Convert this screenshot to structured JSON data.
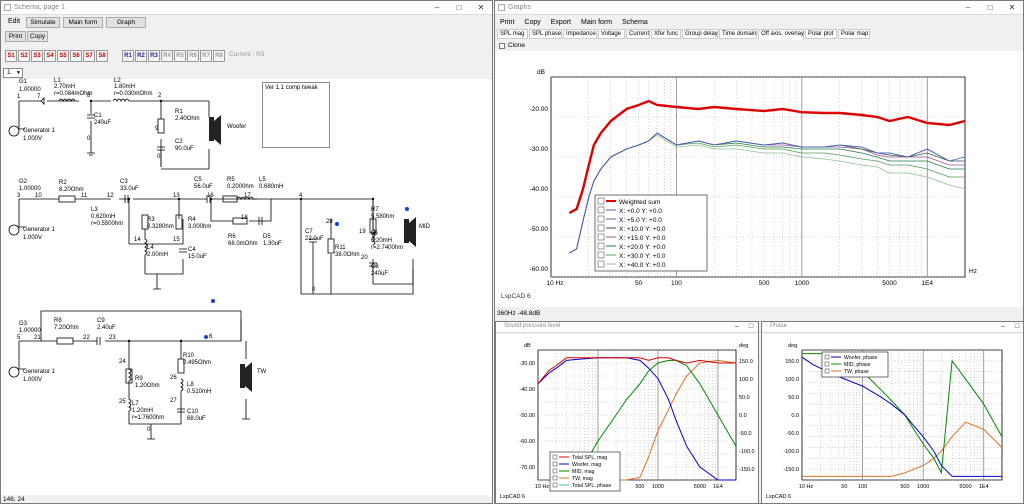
{
  "schema_window": {
    "title": "Schema, page 1",
    "menu": [
      "Edit",
      "Simulate",
      "Main form",
      "Graph"
    ],
    "buttons": [
      "Print",
      "Copy"
    ],
    "s_buttons": [
      "S1",
      "S2",
      "S3",
      "S4",
      "S5",
      "S6",
      "S7",
      "S8"
    ],
    "r_buttons": [
      "R1",
      "R2",
      "R3",
      "R4",
      "R5",
      "R6",
      "R7",
      "R8"
    ],
    "current_label": "Current : R3",
    "page_select": "1",
    "note": "Ver 1.1 comp tweak",
    "status": "146, 24"
  },
  "circuit": {
    "g1": [
      "G1",
      "1.00000",
      "1",
      "7"
    ],
    "gen1": [
      "Generator 1",
      "1.000V"
    ],
    "l1": [
      "L1",
      "2.70mH",
      "r=0.084mOhm",
      "8"
    ],
    "l2": [
      "L2",
      "1.80mH",
      "r=0.030mOhm",
      "2"
    ],
    "c1": [
      "C1",
      "240uF",
      "0"
    ],
    "r1": [
      "R1",
      "2.40Ohm",
      "9"
    ],
    "c2": [
      "C2",
      "90.0uF",
      "0"
    ],
    "woofer": "Woofer",
    "g2": [
      "G2",
      "1.00000",
      "3",
      "10"
    ],
    "r2": [
      "R2",
      "8.20Ohm",
      "11"
    ],
    "c3": [
      "C3",
      "33.0uF",
      "12",
      "13"
    ],
    "c5": [
      "C5",
      "56.0uF",
      "16"
    ],
    "r5": [
      "R5",
      "0.2000hm",
      "17"
    ],
    "l5": [
      "L5",
      "0.680mH",
      "4"
    ],
    "gen2": [
      "Generator 1",
      "1.000V"
    ],
    "l3": [
      "L3",
      "0.620mH",
      "r=0.5500hm"
    ],
    "r3": [
      "R3",
      "0.3280hm",
      "14"
    ],
    "l4": [
      "L4",
      "2.00mH"
    ],
    "r4": [
      "R4",
      "3.000hm",
      "15"
    ],
    "c4": [
      "C4",
      "15.0uF"
    ],
    "r6": [
      "18",
      "R6",
      "68.0mOhm"
    ],
    "d5": [
      "D5",
      "1.30uF"
    ],
    "c7": [
      "C7",
      "22.0uF",
      "0"
    ],
    "n28": "28",
    "r11": [
      "R11",
      "38.0Ohm",
      "20"
    ],
    "r7": [
      "R7",
      "5.580hm",
      "19"
    ],
    "l6": [
      "L6",
      "6.20mH",
      "r=2.7400hm"
    ],
    "c8": [
      "C8",
      "240uF"
    ],
    "mid": "MID",
    "g3": [
      "G3",
      "1.00000",
      "5",
      "21"
    ],
    "r8": [
      "R8",
      "7.20Ohm",
      "22"
    ],
    "c9": [
      "C9",
      "2.40uF",
      "23"
    ],
    "n6": "6",
    "gen3": [
      "Generator 1",
      "1.000V"
    ],
    "r9": [
      "R9",
      "1.20Ohm",
      "24",
      "25"
    ],
    "l7": [
      "L7",
      "1.20mH",
      "r=1.7600hm"
    ],
    "r10": [
      "R10",
      "0.495Ohm",
      "26"
    ],
    "l8": [
      "L8",
      "0.510mH",
      "27"
    ],
    "c10": [
      "C10",
      "68.0uF"
    ],
    "n0": "0",
    "tw": "TW"
  },
  "graphs_window": {
    "title": "Graphs",
    "menu": [
      "Print",
      "Copy",
      "Export",
      "Main form",
      "Schema"
    ],
    "tabs": [
      "SPL mag",
      "SPL phase",
      "Impedance",
      "Voltage",
      "Current",
      "Xfer func",
      "Group delay",
      "Time domain",
      "Off axis, overlay",
      "Polar plot",
      "Polar map"
    ],
    "selected_tab": "Off axis, overlay",
    "clone_label": "Clone",
    "status": "360Hz  -48.8dB",
    "watermark": "LspCAD 6"
  },
  "chart_data": [
    {
      "type": "line",
      "ylabel": "dB",
      "xlabel": "Hz",
      "x_scale": "log",
      "xlim": [
        10,
        20000
      ],
      "ylim": [
        -62,
        -12
      ],
      "y_ticks": [
        "-20.00",
        "-30.00",
        "-40.00",
        "-50.00",
        "-60.00"
      ],
      "x_ticks": [
        "10 Hz",
        "50",
        "100",
        "500",
        "1000",
        "5000",
        "1E4"
      ],
      "legend": [
        "Weighted sum",
        "X: +0.0   Y: +0.0",
        "X: +5.0   Y: +0.0",
        "X: +10.0   Y: +0.0",
        "X: +15.0   Y: +0.0",
        "X: +20.0   Y: +0.0",
        "X: +30.0   Y: +0.0",
        "X: +40.0   Y: +0.0"
      ],
      "colors": [
        "#dd0000",
        "#4060c0",
        "#7060a0",
        "#306030",
        "#a050a0",
        "#208040",
        "#50a050",
        "#90c090"
      ],
      "x": [
        14,
        16,
        18,
        20,
        22,
        25,
        30,
        40,
        50,
        60,
        70,
        100,
        150,
        200,
        300,
        500,
        700,
        1000,
        1500,
        2000,
        3000,
        4000,
        5000,
        7000,
        10000,
        15000,
        20000
      ],
      "series": [
        {
          "name": "Weighted sum",
          "values": [
            -46,
            -45,
            -40,
            -34,
            -29,
            -26,
            -23,
            -20,
            -19,
            -18,
            -19,
            -19.5,
            -20,
            -19.5,
            -20,
            -20.5,
            -20,
            -20.8,
            -21,
            -21,
            -21.5,
            -22,
            -23,
            -22,
            -23.5,
            -24,
            -23
          ]
        },
        {
          "name": "X: +0.0   Y: +0.0",
          "values": [
            -56,
            -55,
            -48,
            -42,
            -38,
            -35,
            -32,
            -30,
            -29,
            -28,
            -26,
            -29,
            -28,
            -29,
            -28,
            -29,
            -28.5,
            -29.5,
            -29.5,
            -29,
            -29.5,
            -31,
            -31,
            -32,
            -30,
            -33,
            -32
          ]
        },
        {
          "name": "X: +5.0   Y: +0.0",
          "values": [
            -56,
            -55,
            -48,
            -42,
            -38,
            -35,
            -32,
            -30,
            -29,
            -28,
            -26,
            -29,
            -28,
            -29,
            -28,
            -29,
            -28.5,
            -29.5,
            -29.5,
            -29,
            -29.5,
            -31,
            -31,
            -32,
            -30,
            -33,
            -33
          ]
        },
        {
          "name": "X: +10.0   Y: +0.0",
          "values": [
            -56,
            -55,
            -48,
            -42,
            -38,
            -35,
            -32,
            -30,
            -29,
            -28,
            -26,
            -29,
            -28,
            -29,
            -28,
            -29,
            -28.5,
            -29.5,
            -29.5,
            -29,
            -30,
            -31,
            -31.5,
            -32,
            -31,
            -33,
            -33
          ]
        },
        {
          "name": "X: +15.0   Y: +0.0",
          "values": [
            -56,
            -55,
            -48,
            -42,
            -38,
            -35,
            -32,
            -30,
            -29,
            -28,
            -26,
            -29,
            -28,
            -29,
            -28,
            -29,
            -29,
            -29.5,
            -29.5,
            -29.5,
            -30,
            -31.5,
            -32,
            -32,
            -32,
            -34,
            -34
          ]
        },
        {
          "name": "X: +20.0   Y: +0.0",
          "values": [
            -56,
            -55,
            -48,
            -42,
            -38,
            -35,
            -32,
            -30,
            -29,
            -28,
            -26,
            -29,
            -28,
            -29,
            -28.5,
            -29.5,
            -29.5,
            -30,
            -30,
            -30,
            -31,
            -32,
            -33,
            -33,
            -33,
            -35,
            -35
          ]
        },
        {
          "name": "X: +30.0   Y: +0.0",
          "values": [
            -56,
            -55,
            -48,
            -42,
            -38,
            -35,
            -32,
            -30,
            -29,
            -28,
            -26,
            -29,
            -28.5,
            -29.5,
            -29,
            -30,
            -30,
            -31,
            -31,
            -31.5,
            -32.5,
            -33,
            -34,
            -34,
            -35,
            -37,
            -37
          ]
        },
        {
          "name": "X: +40.0   Y: +0.0",
          "values": [
            -56,
            -55,
            -48,
            -42,
            -38,
            -35,
            -32,
            -30,
            -29,
            -28,
            -26.5,
            -29.5,
            -29,
            -30,
            -30,
            -31,
            -31,
            -32,
            -32.5,
            -33,
            -34,
            -34.5,
            -36,
            -36,
            -37,
            -39,
            -40
          ]
        }
      ]
    },
    {
      "type": "line",
      "title": "Sound pressure level",
      "ylabel": "dB",
      "y2label": "deg",
      "x_scale": "log",
      "xlim": [
        10,
        20000
      ],
      "ylim": [
        -75,
        -25
      ],
      "y_ticks": [
        "-30.00",
        "-40.00",
        "-50.00",
        "-60.00",
        "-70.00"
      ],
      "y2_ticks": [
        "150.0",
        "100.0",
        "50.0",
        "0.0",
        "-50.0",
        "-100.0",
        "-150.0"
      ],
      "x_ticks": [
        "10 Hz",
        "50",
        "100",
        "500",
        "1000",
        "5000",
        "1E4"
      ],
      "legend": [
        "Total SPL, mag",
        "Woofer, mag",
        "MID, mag",
        "TW, mag",
        "Total SPL, phase"
      ],
      "colors": [
        "#dd0000",
        "#0000cc",
        "#008800",
        "#e07020",
        "#40c0c0"
      ],
      "x": [
        10,
        15,
        20,
        30,
        50,
        100,
        200,
        300,
        500,
        700,
        1000,
        1500,
        2000,
        3000,
        5000,
        10000,
        20000
      ],
      "series": [
        {
          "name": "Total SPL, mag",
          "values": [
            -38,
            -33,
            -31,
            -28,
            -28,
            -28,
            -28,
            -28,
            -28,
            -29,
            -28,
            -28,
            -29,
            -30,
            -29,
            -30,
            -30
          ]
        },
        {
          "name": "Woofer, mag",
          "values": [
            -38,
            -34,
            -32,
            -29,
            -28.5,
            -28,
            -28,
            -28,
            -29,
            -32,
            -36,
            -44,
            -52,
            -62,
            -70,
            -75,
            -75
          ]
        },
        {
          "name": "MID, mag",
          "values": [
            -75,
            -75,
            -75,
            -75,
            -72,
            -60,
            -50,
            -44,
            -38,
            -33,
            -30,
            -29,
            -29,
            -31,
            -38,
            -50,
            -62
          ]
        },
        {
          "name": "TW, mag",
          "values": [
            -75,
            -75,
            -75,
            -75,
            -75,
            -75,
            -75,
            -75,
            -74,
            -66,
            -56,
            -48,
            -42,
            -35,
            -30,
            -29,
            -30
          ]
        }
      ]
    },
    {
      "type": "line",
      "title": "Phase",
      "ylabel": "deg",
      "x_scale": "log",
      "xlim": [
        10,
        20000
      ],
      "ylim": [
        -180,
        180
      ],
      "y_ticks": [
        "150.0",
        "100.0",
        "50.0",
        "0.0",
        "-50.0",
        "-100.0",
        "-150.0"
      ],
      "x_ticks": [
        "10 Hz",
        "50",
        "100",
        "500",
        "1000",
        "5000",
        "1E4"
      ],
      "legend": [
        "Woofer, phase",
        "MID, phase",
        "TW, phase"
      ],
      "colors": [
        "#0000cc",
        "#008800",
        "#e07020"
      ],
      "x": [
        10,
        15,
        20,
        30,
        50,
        100,
        200,
        300,
        500,
        700,
        1000,
        1500,
        2000,
        3000,
        5000,
        10000,
        20000
      ],
      "series": [
        {
          "name": "Woofer, phase",
          "values": [
            160,
            140,
            130,
            115,
            100,
            80,
            50,
            30,
            0,
            -30,
            -60,
            -100,
            -140,
            -170,
            -170,
            -170,
            -170
          ]
        },
        {
          "name": "MID, phase",
          "values": [
            170,
            170,
            170,
            170,
            150,
            120,
            70,
            40,
            0,
            -40,
            -80,
            -120,
            -160,
            150,
            100,
            30,
            -60
          ]
        },
        {
          "name": "TW, phase",
          "values": [
            -170,
            -170,
            -170,
            -170,
            -170,
            -170,
            -170,
            -170,
            -160,
            -150,
            -140,
            -120,
            -100,
            -60,
            -20,
            -40,
            -90
          ]
        }
      ]
    }
  ]
}
